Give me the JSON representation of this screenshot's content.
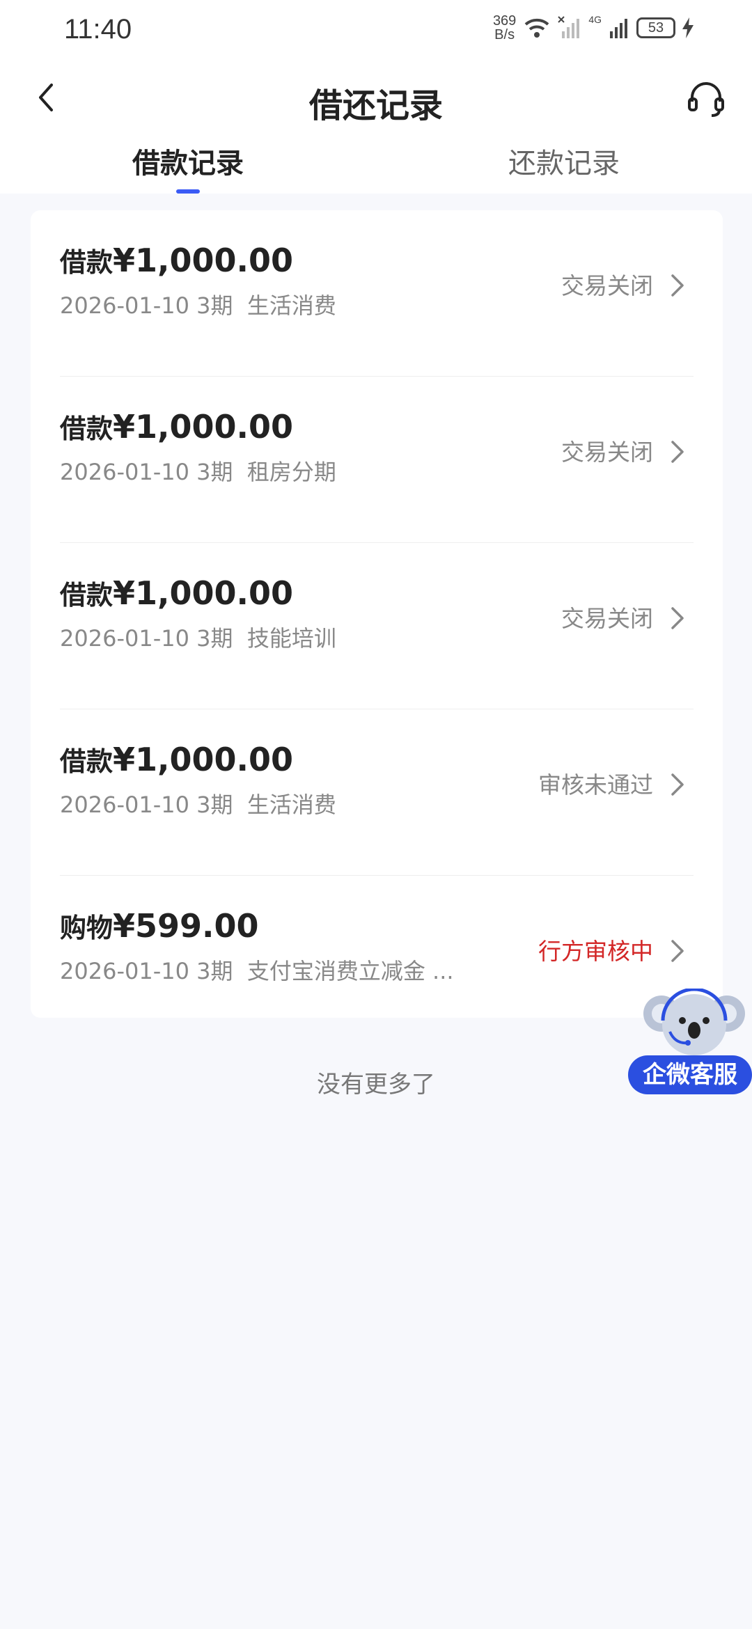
{
  "status_bar": {
    "time": "11:40",
    "net_speed_value": "369",
    "net_speed_unit": "B/s",
    "battery": "53",
    "network": "4G"
  },
  "header": {
    "title": "借还记录",
    "back_icon": "chevron-left-icon",
    "service_icon": "headset-icon"
  },
  "tabs": [
    {
      "label": "借款记录",
      "active": true
    },
    {
      "label": "还款记录",
      "active": false
    }
  ],
  "records": [
    {
      "type": "借款",
      "amount": "¥1,000.00",
      "date": "2026-01-10",
      "periods": "3期",
      "purpose": "生活消费",
      "status": "交易关闭"
    },
    {
      "type": "借款",
      "amount": "¥1,000.00",
      "date": "2026-01-10",
      "periods": "3期",
      "purpose": "租房分期",
      "status": "交易关闭"
    },
    {
      "type": "借款",
      "amount": "¥1,000.00",
      "date": "2026-01-10",
      "periods": "3期",
      "purpose": "技能培训",
      "status": "交易关闭"
    },
    {
      "type": "借款",
      "amount": "¥1,000.00",
      "date": "2026-01-10",
      "periods": "3期",
      "purpose": "生活消费",
      "status": "审核未通过"
    },
    {
      "type": "购物",
      "amount": "¥599.00",
      "date": "2026-01-10",
      "periods": "3期",
      "purpose": "支付宝消费立减金 ...",
      "status": "行方审核中"
    }
  ],
  "footer": {
    "no_more": "没有更多了"
  },
  "floating_service": {
    "label": "企微客服",
    "icon": "koala-mascot-icon"
  },
  "colors": {
    "accent": "#3b5bf5",
    "status_pending": "#d32727",
    "service_pill": "#2b4fe0"
  }
}
